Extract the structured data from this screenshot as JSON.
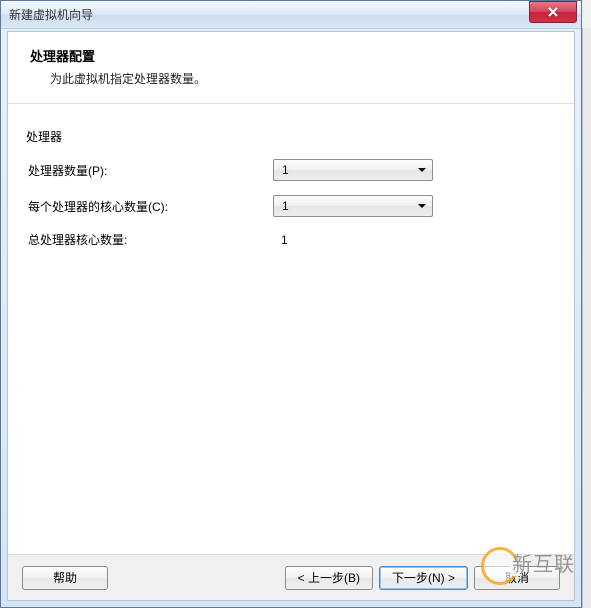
{
  "window": {
    "title": "新建虚拟机向导"
  },
  "header": {
    "title": "处理器配置",
    "subtitle": "为此虚拟机指定处理器数量。"
  },
  "body": {
    "section_label": "处理器",
    "rows": {
      "processors": {
        "label": "处理器数量(P):",
        "value": "1"
      },
      "cores": {
        "label": "每个处理器的核心数量(C):",
        "value": "1"
      },
      "total": {
        "label": "总处理器核心数量:",
        "value": "1"
      }
    }
  },
  "footer": {
    "help": "帮助",
    "back": "< 上一步(B)",
    "next": "下一步(N) >",
    "cancel": "取消"
  },
  "watermark": {
    "text": "新互联"
  }
}
